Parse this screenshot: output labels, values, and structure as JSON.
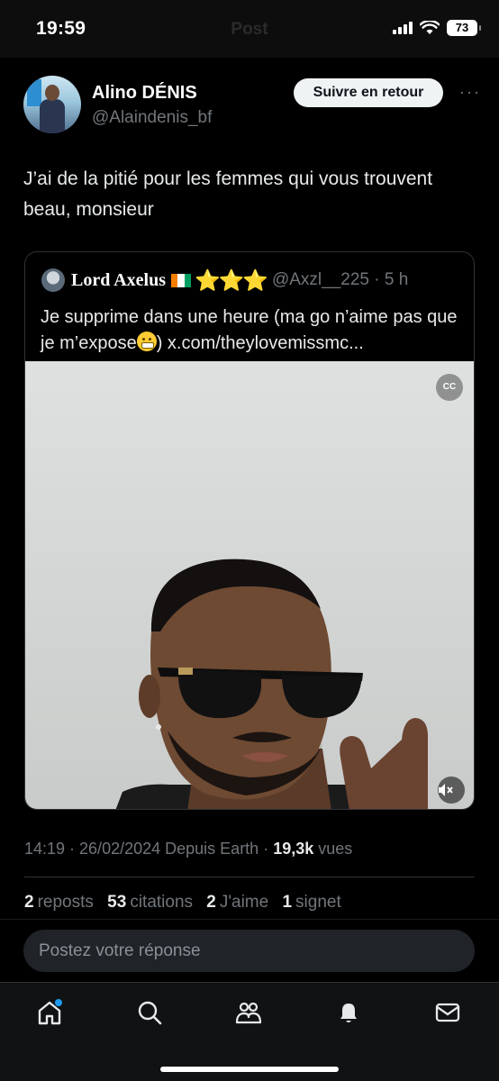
{
  "status_bar": {
    "time": "19:59",
    "title": "Post",
    "battery": "73"
  },
  "tweet": {
    "author_name": "Alino DÉNIS",
    "author_handle": "@Alaindenis_bf",
    "follow_label": "Suivre en retour",
    "more_label": "···",
    "text": "J’ai de la pitié pour les femmes qui vous trouvent beau, monsieur"
  },
  "quote": {
    "author_name": "Lord Axelus",
    "stars": "⭐⭐⭐",
    "handle_time": "@Axzl__225 · 5 h",
    "text_before_emoji": "Je supprime dans une heure (ma go n’aime pas que je m’expose",
    "text_after_emoji": ") x.com/theylovemissmc...",
    "cc_label": "CC",
    "mute_icon": "speaker-mute-icon"
  },
  "meta": {
    "time_date": "14:19 · 26/02/2024",
    "source": " Depuis Earth · ",
    "views_count": "19,3k",
    "views_label": " vues"
  },
  "stats": {
    "reposts_count": "2",
    "reposts_label": "reposts",
    "quotes_count": "53",
    "quotes_label": "citations",
    "likes_count": "2",
    "likes_label": "J'aime",
    "bookmarks_count": "1",
    "bookmarks_label": "signet"
  },
  "reply": {
    "placeholder": "Postez votre réponse"
  },
  "tabs": [
    {
      "name": "home-icon"
    },
    {
      "name": "search-icon"
    },
    {
      "name": "communities-icon"
    },
    {
      "name": "notifications-icon"
    },
    {
      "name": "messages-icon"
    }
  ],
  "colors": {
    "background": "#000000",
    "text_primary": "#e7e9ea",
    "text_secondary": "#71767b",
    "border": "#2f3336",
    "accent": "#1d9bf0",
    "star": "#ffcc33"
  }
}
